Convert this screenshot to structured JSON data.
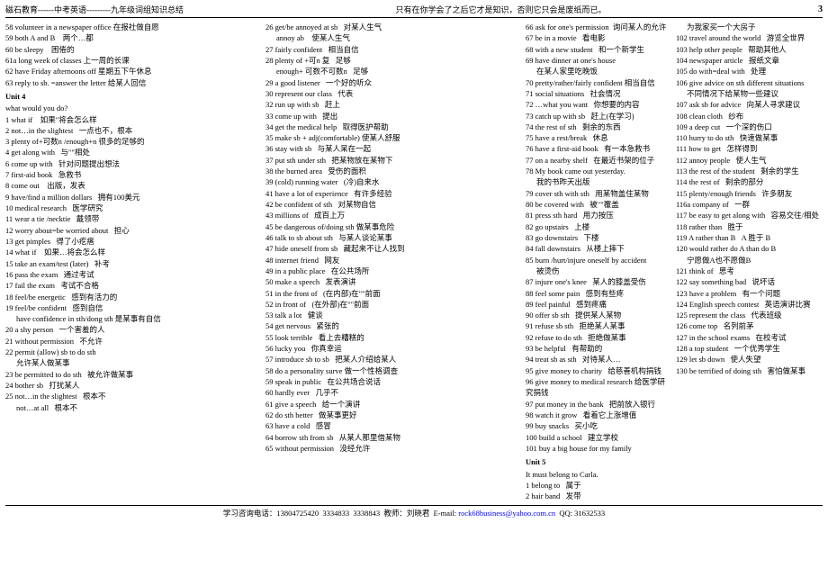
{
  "header": {
    "left": "磁石教育------中考英语---------九年级词组知识总结",
    "right": "只有在你学会了之后它才是知识，否则它只会是废纸而已。",
    "page": "3"
  },
  "footer": {
    "phone1": "13804725420",
    "phone2": "3334833",
    "phone3": "3338843",
    "teacher": "教师：刘晓君",
    "email_label": "E-mail:",
    "email": "rock68business@yahoo.com.cn",
    "qq": "QQ: 31632533"
  },
  "col1_entries": [
    {
      "num": "58",
      "en": "volunteer in a newspaper office",
      "cn": "在报社做自愿"
    },
    {
      "num": "59",
      "en": "both A and B",
      "cn": "两个…都"
    },
    {
      "num": "60",
      "en": "be sleepy",
      "cn": "困倦的"
    },
    {
      "num": "61a",
      "en": "long week of classes",
      "cn": "上一周的长课"
    },
    {
      "num": "62",
      "en": "have Friday afternoons off",
      "cn": "星期五下午休息"
    },
    {
      "num": "63",
      "en": "reply to sb. =answer the letter",
      "cn": "给某人回信"
    },
    {
      "unit": "Unit 4"
    },
    {
      "text": "what would you do?"
    },
    {
      "num": "1",
      "en": "what if",
      "cn": "如果\"将会怎么样"
    },
    {
      "num": "2",
      "en": "not…in the slightest",
      "cn": "一点也不，根本"
    },
    {
      "num": "3",
      "en": "plenty of+可数n /enough+n",
      "cn": "很多的足够的"
    },
    {
      "num": "4",
      "en": "get along with",
      "cn": "与\"\"相处"
    },
    {
      "num": "6",
      "en": "come up with",
      "cn": "针对问题提出想法"
    },
    {
      "num": "7",
      "en": "first-aid book",
      "cn": "急救书"
    },
    {
      "num": "8",
      "en": "come out",
      "cn": "出版，发表"
    },
    {
      "num": "9",
      "en": "have/find a million dollars",
      "cn": "拥有100美元"
    },
    {
      "num": "10",
      "en": "medical research",
      "cn": "医学研究"
    },
    {
      "num": "11",
      "en": "wear a tie /necktie",
      "cn": "戴领带"
    },
    {
      "num": "12",
      "en": "worry about=be worried about",
      "cn": "担心"
    },
    {
      "num": "13",
      "en": "get pimples",
      "cn": "得了小疙瘩"
    },
    {
      "num": "14",
      "en": "what if",
      "cn": "如果…将会怎么样"
    },
    {
      "num": "15",
      "en": "take an exam/test (later)",
      "cn": "补考"
    },
    {
      "num": "16",
      "en": "pass the exam",
      "cn": "通过考试"
    },
    {
      "num": "17",
      "en": "fail the exam",
      "cn": "考试不合格"
    },
    {
      "num": "18",
      "en": "feel/be energetic",
      "cn": "感到有活力的"
    },
    {
      "num": "19",
      "en": "feel/be confident",
      "cn": "感到自信"
    },
    {
      "num": "",
      "en": "have confidence in sth/dong sth",
      "cn": "是某事有自信"
    },
    {
      "num": "20",
      "en": "a shy person",
      "cn": "一个害羞的人"
    },
    {
      "num": "21",
      "en": "without permission",
      "cn": "不允许"
    },
    {
      "num": "22",
      "en": "permit (allow) sb to do sth",
      "cn": "允许某人做某事"
    },
    {
      "num": "23",
      "en": "be permitted to do sth",
      "cn": "被允许做某事"
    },
    {
      "num": "24",
      "en": "bother sb",
      "cn": "打扰某人"
    },
    {
      "num": "25",
      "en": "not…in the slightest",
      "cn": "根本不"
    },
    {
      "num": "",
      "en": "not…at all",
      "cn": "根本不"
    }
  ],
  "col2_entries": [
    {
      "num": "26",
      "en": "get/be annoyed at sb",
      "cn": "对某人生气"
    },
    {
      "num": "",
      "en": "annoy ab",
      "cn": "使某人生气"
    },
    {
      "num": "27",
      "en": "fairly confident",
      "cn": "相当自信"
    },
    {
      "num": "28",
      "en": "plenty of +可n 复",
      "cn": "足够"
    },
    {
      "num": "",
      "en": "enough+ 可数不可数n",
      "cn": "足够"
    },
    {
      "num": "29",
      "en": "a good listener",
      "cn": "一个好的听众"
    },
    {
      "num": "30",
      "en": "represent our class",
      "cn": "代表"
    },
    {
      "num": "32",
      "en": "run up with sb",
      "cn": "赶上"
    },
    {
      "num": "33",
      "en": "come up with",
      "cn": "提出"
    },
    {
      "num": "34",
      "en": "get the medical help",
      "cn": "取得医护帮助"
    },
    {
      "num": "35",
      "en": "make sb + adj(comfortable)",
      "cn": "使某人舒服"
    },
    {
      "num": "36",
      "en": "stay with sb",
      "cn": "与某人呆在一起"
    },
    {
      "num": "37",
      "en": "put sth under sth",
      "cn": "把某物放在某物下"
    },
    {
      "num": "38",
      "en": "the burned area",
      "cn": "受伤的面积"
    },
    {
      "num": "39",
      "en": "(cold) running water",
      "cn": "(冷)自来水"
    },
    {
      "num": "41",
      "en": "have a lot of experience",
      "cn": "有许多经验"
    },
    {
      "num": "42",
      "en": "be confident of sth",
      "cn": "对某物自信"
    },
    {
      "num": "43",
      "en": "millions of",
      "cn": "成百上万"
    },
    {
      "num": "45",
      "en": "be dangerous of/doing sth",
      "cn": "做某事危险"
    },
    {
      "num": "46",
      "en": "talk to sb about sth",
      "cn": "与某人谈论某事"
    },
    {
      "num": "47",
      "en": "hide oneself from sb",
      "cn": "藏起来不让人找到"
    },
    {
      "num": "48",
      "en": "internet friend",
      "cn": "网友"
    },
    {
      "num": "49",
      "en": "in a public place",
      "cn": "在公共场所"
    },
    {
      "num": "50",
      "en": "make a speech",
      "cn": "发表演讲"
    },
    {
      "num": "51",
      "en": "in the front of",
      "cn": "(在内部)在\"\"前面"
    },
    {
      "num": "52",
      "en": "in front of",
      "cn": "(在外部)在\"\"前面"
    },
    {
      "num": "53",
      "en": "talk a lot",
      "cn": "健谈"
    },
    {
      "num": "54",
      "en": "get nervous",
      "cn": "紧张的"
    },
    {
      "num": "55",
      "en": "look terrible",
      "cn": "看上去糟糕的"
    },
    {
      "num": "56",
      "en": "lucky you",
      "cn": "你真幸运"
    },
    {
      "num": "57",
      "en": "introduce sb to sb",
      "cn": "把某人介绍给某人"
    },
    {
      "num": "58",
      "en": "do a personality surve",
      "cn": "做一个性格调查"
    },
    {
      "num": "59",
      "en": "speak in public",
      "cn": "在公共场合说话"
    },
    {
      "num": "60",
      "en": "hardly ever",
      "cn": "几乎不"
    },
    {
      "num": "61",
      "en": "give a speech",
      "cn": "给一个演讲"
    },
    {
      "num": "62",
      "en": "do sth better",
      "cn": "做某事更好"
    },
    {
      "num": "63",
      "en": "have a cold",
      "cn": "感冒"
    },
    {
      "num": "64",
      "en": "borrow sth from sb",
      "cn": "从某人那里借某物"
    },
    {
      "num": "65",
      "en": "without permission",
      "cn": "没经允许"
    }
  ],
  "col3_entries": [
    {
      "num": "66",
      "en": "ask for one's permission",
      "cn": "询问某人的允许"
    },
    {
      "num": "67",
      "en": "be in a movie",
      "cn": "看电影"
    },
    {
      "num": "68",
      "en": "with a new student",
      "cn": "和一个新学生"
    },
    {
      "num": "69",
      "en": "have dinner at one's house",
      "cn": "在某人家里吃晚饭"
    },
    {
      "num": "70",
      "en": "pretty/rather/fairly confident",
      "cn": "相当自信"
    },
    {
      "num": "71",
      "en": "social situations",
      "cn": "社会情况"
    },
    {
      "num": "72",
      "en": "…what you want",
      "cn": "你想要的内容"
    },
    {
      "num": "73",
      "en": "catch up with sb",
      "cn": "赶上(在学习)"
    },
    {
      "num": "74",
      "en": "the rest of sth",
      "cn": "剩余的东西"
    },
    {
      "num": "75",
      "en": "have a rest/break",
      "cn": "休息"
    },
    {
      "num": "76",
      "en": "have a first-aid book",
      "cn": "有一本急救书"
    },
    {
      "num": "77",
      "en": "on a nearby shelf",
      "cn": "在最近书架的位子"
    },
    {
      "num": "78",
      "en": "My book came out yesterday.",
      "cn": ""
    },
    {
      "num": "",
      "en": "我的书昨天出版",
      "cn": ""
    },
    {
      "num": "79",
      "en": "cover sth with sth",
      "cn": "用某物盖住某物"
    },
    {
      "num": "80",
      "en": "be covered with",
      "cn": "被\"\"覆盖"
    },
    {
      "num": "81",
      "en": "press sth hard",
      "cn": "用力按压"
    },
    {
      "num": "82",
      "en": "go upstairs",
      "cn": "上楼"
    },
    {
      "num": "83",
      "en": "go downstairs",
      "cn": "下楼"
    },
    {
      "num": "84",
      "en": "fall downstairs",
      "cn": "从楼上摔下"
    },
    {
      "num": "85",
      "en": "burn /hurt/injure oneself by accident",
      "cn": "被烫伤"
    },
    {
      "num": "87",
      "en": "injure one's knee",
      "cn": "某人的膝盖受伤"
    },
    {
      "num": "88",
      "en": "feel some pain",
      "cn": "感到有些疼"
    },
    {
      "num": "89",
      "en": "feel painful",
      "cn": "感到疼痛"
    },
    {
      "num": "90",
      "en": "offer sb sth",
      "cn": "提供某人某物"
    },
    {
      "num": "91",
      "en": "refuse sb sth",
      "cn": "拒绝某人某事"
    },
    {
      "num": "92",
      "en": "refuse to do sth",
      "cn": "拒绝做某事"
    },
    {
      "num": "93",
      "en": "be helpful",
      "cn": "有帮助的"
    },
    {
      "num": "94",
      "en": "treat sb as sth",
      "cn": "对待某人…"
    },
    {
      "num": "95",
      "en": "give money to charity",
      "cn": "给慈善机构捐钱"
    },
    {
      "num": "96",
      "en": "give money to medical research",
      "cn": "给医学研究捐钱"
    },
    {
      "num": "97",
      "en": "put money in the bank",
      "cn": "把前放入银行"
    },
    {
      "num": "98",
      "en": "watch it grow",
      "cn": "看着它上涨增值"
    },
    {
      "num": "99",
      "en": "buy snacks",
      "cn": "买小吃"
    },
    {
      "num": "100",
      "en": "build a school",
      "cn": "建立学校"
    },
    {
      "num": "101",
      "en": "buy a big house for my family",
      "cn": ""
    },
    {
      "unit": "Unit 5"
    },
    {
      "text": "It must belong to Carla."
    },
    {
      "num": "1",
      "en": "belong to",
      "cn": "属于"
    },
    {
      "num": "2",
      "en": "hair band",
      "cn": "发带"
    }
  ],
  "col3_right": [
    {
      "num": "102",
      "en": "travel around the world",
      "cn": "游览全世界"
    },
    {
      "num": "103",
      "en": "help other people",
      "cn": "帮助其他人"
    },
    {
      "num": "104",
      "en": "newspaper article",
      "cn": "报纸文章"
    },
    {
      "num": "105",
      "en": "do with=deal with",
      "cn": "处理"
    },
    {
      "num": "106",
      "en": "give advice on sth different situations",
      "cn": ""
    },
    {
      "num": "",
      "en": "不同情况下给某物一些建议",
      "cn": ""
    },
    {
      "num": "107",
      "en": "ask sb for advice",
      "cn": "向某人寻求建议"
    },
    {
      "num": "108",
      "en": "clean cloth",
      "cn": "纱布"
    },
    {
      "num": "109",
      "en": "a deep cut",
      "cn": "一个深的伤口"
    },
    {
      "num": "110",
      "en": "hurry to do sth",
      "cn": "快速做某事"
    },
    {
      "num": "111",
      "en": "how to get",
      "cn": "怎样得到"
    },
    {
      "num": "112",
      "en": "annoy people",
      "cn": "使人生气"
    },
    {
      "num": "113",
      "en": "the rest of the student",
      "cn": "剩余的学生"
    },
    {
      "num": "114",
      "en": "the rest of",
      "cn": "剩余的部分"
    },
    {
      "num": "115",
      "en": "plenty/enough friends",
      "cn": "许多朋友"
    },
    {
      "num": "116a",
      "en": "company of",
      "cn": "一群"
    },
    {
      "num": "117",
      "en": "be easy to get along with",
      "cn": "容易交往/相处"
    },
    {
      "num": "118",
      "en": "rather than",
      "cn": "胜于"
    },
    {
      "num": "119",
      "en": "A rather than B",
      "cn": "A 胜于 B"
    },
    {
      "num": "120",
      "en": "would rather do A than do B",
      "cn": "宁愿做A也不愿做B"
    },
    {
      "num": "121",
      "en": "think of",
      "cn": "思考"
    },
    {
      "num": "122",
      "en": "say something bad",
      "cn": "说坏话"
    },
    {
      "num": "123",
      "en": "have a problem",
      "cn": "有一个问题"
    },
    {
      "num": "124",
      "en": "English speech contest",
      "cn": "英语演讲比赛"
    },
    {
      "num": "125",
      "en": "represent the class",
      "cn": "代表班级"
    },
    {
      "num": "126",
      "en": "come top",
      "cn": "名列前茅"
    },
    {
      "num": "127",
      "en": "in the school exams",
      "cn": "在校考试"
    },
    {
      "num": "128",
      "en": "a top student",
      "cn": "一个优秀学生"
    },
    {
      "num": "129",
      "en": "let sb down",
      "cn": "使人失望"
    },
    {
      "num": "130",
      "en": "be terrified of doing sth",
      "cn": "害怕做某事"
    }
  ]
}
